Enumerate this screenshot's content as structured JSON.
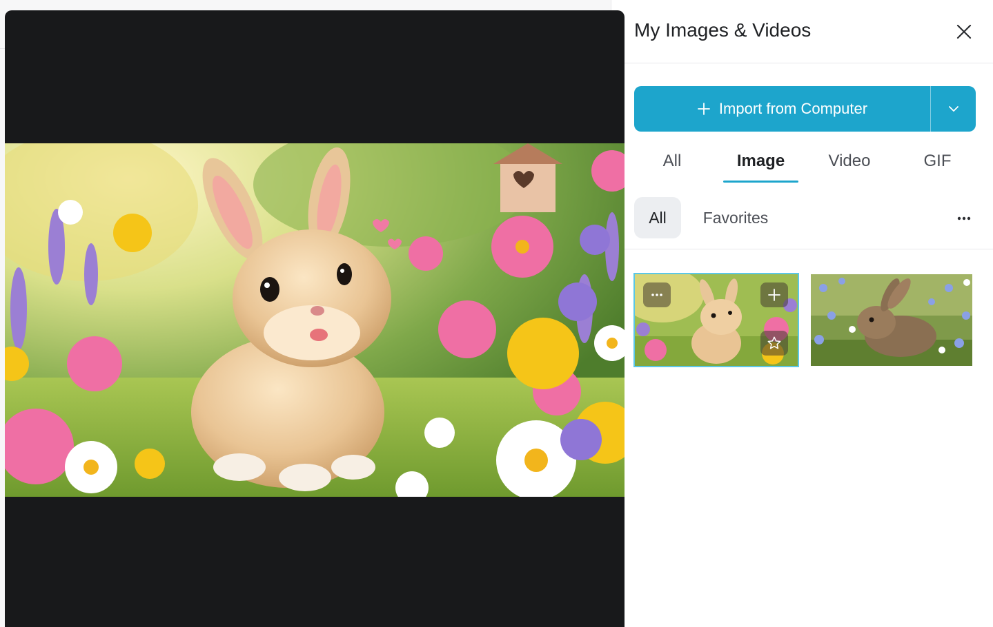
{
  "panel": {
    "title": "My Images & Videos",
    "import_label": "Import from Computer",
    "tabs": [
      {
        "label": "All",
        "active": false
      },
      {
        "label": "Image",
        "active": true
      },
      {
        "label": "Video",
        "active": false
      },
      {
        "label": "GIF",
        "active": false
      }
    ],
    "filters": [
      {
        "label": "All",
        "active": true
      },
      {
        "label": "Favorites",
        "active": false
      }
    ]
  },
  "icons": {
    "close": "close-icon",
    "import": "plus-icon",
    "dropdown": "chevron-down-icon",
    "more": "more-horizontal-icon",
    "thumb_more": "more-horizontal-icon",
    "thumb_add": "plus-icon",
    "thumb_favorite": "star-icon"
  },
  "colors": {
    "accent": "#1da5cc",
    "preview_bg": "#18191b",
    "selected_outline": "#5bc7e6"
  }
}
